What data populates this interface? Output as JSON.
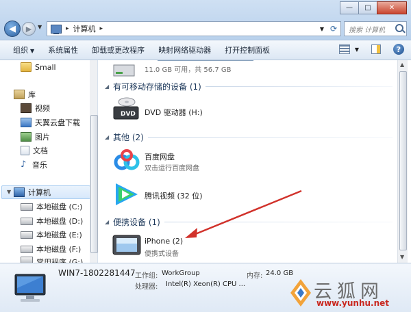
{
  "window": {
    "minimize_glyph": "—",
    "maximize_glyph": "□",
    "close_glyph": "✕"
  },
  "address": {
    "sep": "▸",
    "path": "计算机",
    "search_placeholder": "搜索 计算机"
  },
  "toolbar": {
    "organize": "组织",
    "system_properties": "系统属性",
    "uninstall": "卸载或更改程序",
    "map_drive": "映射网络驱动器",
    "control_panel": "打开控制面板",
    "help_glyph": "?"
  },
  "nav": {
    "small": "Small",
    "library": "库",
    "videos": "视频",
    "tianyi": "天翼云盘下载",
    "pictures": "图片",
    "documents": "文档",
    "music": "音乐",
    "computer": "计算机",
    "drive_c": "本地磁盘 (C:)",
    "drive_d": "本地磁盘 (D:)",
    "drive_e": "本地磁盘 (E:)",
    "drive_f": "本地磁盘 (F:)",
    "drive_g": "常用程序 (G:)"
  },
  "content": {
    "drive_free": "11.0 GB 可用，共 56.7 GB",
    "drive_usage_fraction": 0.81,
    "group_removable": "有可移动存储的设备 (1)",
    "dvd_name": "DVD 驱动器 (H:)",
    "group_other": "其他 (2)",
    "baidu_name": "百度网盘",
    "baidu_sub": "双击运行百度网盘",
    "tencent_name": "腾讯视频 (32 位)",
    "group_portable": "便携设备 (1)",
    "iphone_name": "iPhone (2)",
    "iphone_sub": "便携式设备"
  },
  "details": {
    "computer_name": "WIN7-1802281447",
    "workgroup_label": "工作组:",
    "workgroup_value": "WorkGroup",
    "memory_label": "内存:",
    "memory_value": "24.0 GB",
    "cpu_label": "处理器:",
    "cpu_value": "Intel(R) Xeon(R) CPU ..."
  },
  "watermark": {
    "text": "云狐网",
    "url": "www.yunhu.net"
  },
  "colors": {
    "accent": "#1e395b",
    "arrow": "#d1322b",
    "drive_bar": "#3a8de0"
  }
}
